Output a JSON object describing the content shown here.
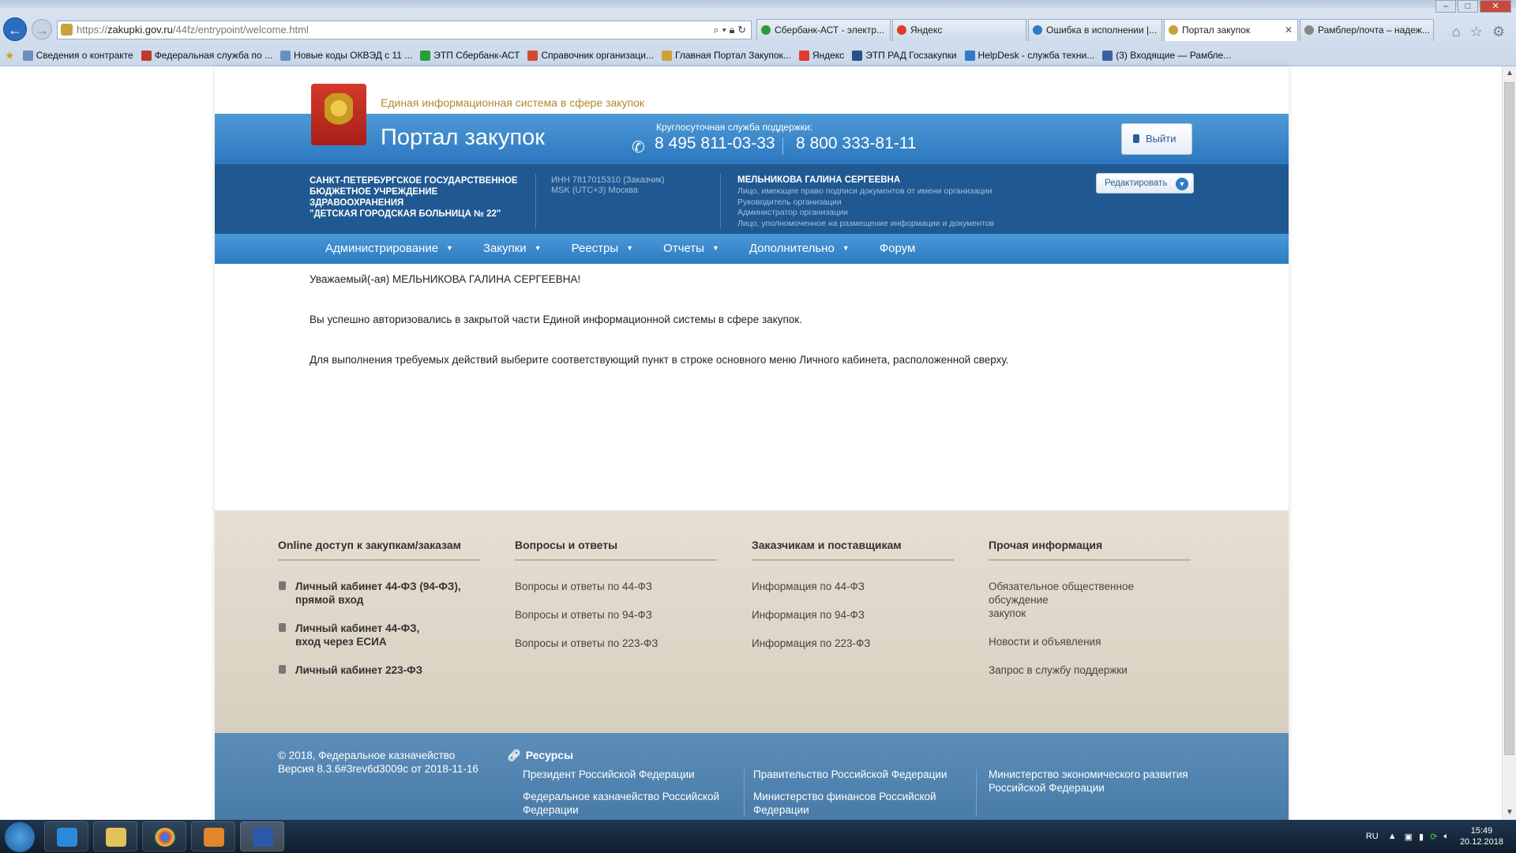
{
  "browser": {
    "url_prefix": "https://",
    "url_host": "zakupki.gov.ru",
    "url_path": "/44fz/entrypoint/welcome.html",
    "tabs": [
      {
        "label": "Сбербанк-АСТ - электр...",
        "active": false,
        "color": "#2e9b3a"
      },
      {
        "label": "Яндекс",
        "active": false,
        "color": "#e03b2e"
      },
      {
        "label": "Ошибка в исполнении |...",
        "active": false,
        "color": "#2f7bc4"
      },
      {
        "label": "Портал закупок",
        "active": true,
        "color": "#c9a23a"
      },
      {
        "label": "Рамблер/почта – надеж...",
        "active": false,
        "color": "#888888"
      }
    ],
    "favorites": [
      {
        "label": "Сведения о контракте",
        "color": "#6a8fbf"
      },
      {
        "label": "Федеральная служба по ...",
        "color": "#c0392b"
      },
      {
        "label": "Новые коды ОКВЭД с 11 ...",
        "color": "#6a8fbf"
      },
      {
        "label": "ЭТП Сбербанк-АСТ",
        "color": "#2e9b3a"
      },
      {
        "label": "Справочник организаци...",
        "color": "#d04b2f"
      },
      {
        "label": "Главная Портал Закупок...",
        "color": "#c9a23a"
      },
      {
        "label": "Яндекс",
        "color": "#e03b2e"
      },
      {
        "label": "ЭТП РАД Госзакупки",
        "color": "#2b4f8a"
      },
      {
        "label": "HelpDesk - служба техни...",
        "color": "#2f7bc4"
      },
      {
        "label": "(3) Входящие — Рамбле...",
        "color": "#3b5fa0"
      }
    ]
  },
  "header": {
    "ais_title": "Единая информационная система в сфере закупок",
    "portal_title": "Портал закупок",
    "support_label": "Круглосуточная служба поддержки:",
    "phone1": "8 495 811-03-33",
    "phone2": "8 800 333-81-11",
    "logout_label": "Выйти"
  },
  "org": {
    "name_line1": "САНКТ-ПЕТЕРБУРГСКОЕ ГОСУДАРСТВЕННОЕ",
    "name_line2": "БЮДЖЕТНОЕ УЧРЕЖДЕНИЕ ЗДРАВООХРАНЕНИЯ",
    "name_line3": "\"ДЕТСКАЯ ГОРОДСКАЯ БОЛЬНИЦА № 22\"",
    "inn": "ИНН 7817015310 (Заказчик)",
    "timezone": "MSK (UTC+3) Москва",
    "user_name": "МЕЛЬНИКОВА ГАЛИНА СЕРГЕЕВНА",
    "roles": [
      "Лицо, имеющее право подписи документов от имени организации",
      "Руководитель организации",
      "Администратор организации",
      "Лицо, уполномоченное на размещение информации и документов"
    ],
    "edit_label": "Редактировать"
  },
  "nav": {
    "items": [
      "Администрирование",
      "Закупки",
      "Реестры",
      "Отчеты",
      "Дополнительно",
      "Форум"
    ]
  },
  "content": {
    "greeting": "Уважаемый(-ая) МЕЛЬНИКОВА ГАЛИНА СЕРГЕЕВНА!",
    "line1": "Вы успешно авторизовались в закрытой части Единой информационной системы в сфере закупок.",
    "line2": "Для выполнения требуемых действий выберите соответствующий пункт в строке основного меню Личного кабинета, расположенной сверху."
  },
  "footer": {
    "col1": {
      "title": "Online доступ к закупкам/заказам",
      "items": [
        "Личный кабинет 44-ФЗ (94-ФЗ),",
        "прямой вход",
        "Личный кабинет 44-ФЗ,",
        "вход через ЕСИА",
        "Личный кабинет 223-ФЗ"
      ]
    },
    "col2": {
      "title": "Вопросы и ответы",
      "items": [
        "Вопросы и ответы по 44-ФЗ",
        "Вопросы и ответы по 94-ФЗ",
        "Вопросы и ответы по 223-ФЗ"
      ]
    },
    "col3": {
      "title": "Заказчикам и поставщикам",
      "items": [
        "Информация по 44-ФЗ",
        "Информация по 94-ФЗ",
        "Информация по 223-ФЗ"
      ]
    },
    "col4": {
      "title": "Прочая информация",
      "items": [
        "Обязательное общественное обсуждение",
        "закупок",
        "Новости и объявления",
        "Запрос в службу поддержки"
      ]
    }
  },
  "bottom": {
    "copyright": "© 2018, Федеральное казначейство",
    "version": "Версия 8.3.6#3rev6d3009c от 2018-11-16",
    "resources_title": "Ресурсы",
    "links": [
      "Президент Российской Федерации",
      "Правительство Российской Федерации",
      "Министерство экономического развития",
      "Российской Федерации",
      "Федеральное казначейство Российской",
      "Федерации",
      "Министерство финансов Российской",
      "Федерации"
    ]
  },
  "taskbar": {
    "lang": "RU",
    "time": "15:49",
    "date": "20.12.2018"
  }
}
